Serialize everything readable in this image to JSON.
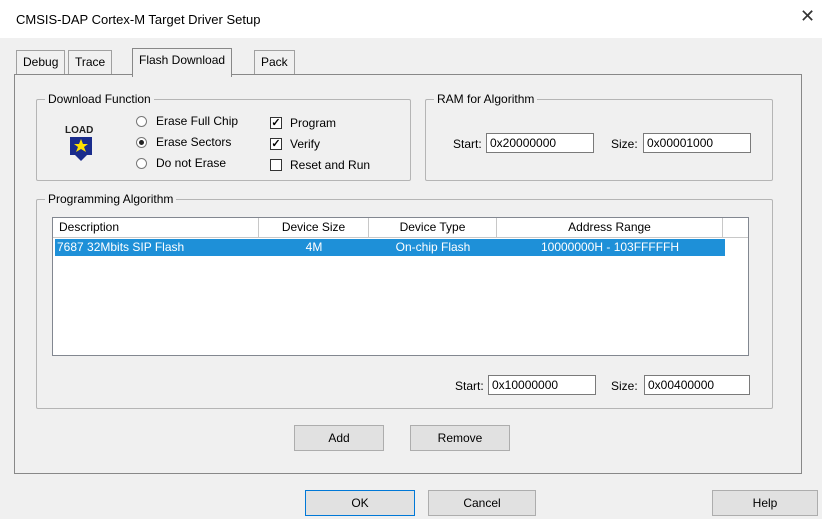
{
  "window": {
    "title": "CMSIS-DAP Cortex-M Target Driver Setup",
    "close_glyph": "✕"
  },
  "tabs": [
    {
      "label": "Debug"
    },
    {
      "label": "Trace"
    },
    {
      "label": "Flash Download"
    },
    {
      "label": "Pack"
    }
  ],
  "download_function": {
    "group_label": "Download Function",
    "load_icon_text": "LOAD",
    "radios": [
      {
        "label": "Erase Full Chip",
        "checked": false
      },
      {
        "label": "Erase Sectors",
        "checked": true
      },
      {
        "label": "Do not Erase",
        "checked": false
      }
    ],
    "checkboxes": [
      {
        "label": "Program",
        "checked": true
      },
      {
        "label": "Verify",
        "checked": true
      },
      {
        "label": "Reset and Run",
        "checked": false
      }
    ]
  },
  "ram": {
    "group_label": "RAM for Algorithm",
    "start_label": "Start:",
    "start_value": "0x20000000",
    "size_label": "Size:",
    "size_value": "0x00001000"
  },
  "programming": {
    "group_label": "Programming Algorithm",
    "columns": [
      "Description",
      "Device Size",
      "Device Type",
      "Address Range"
    ],
    "rows": [
      [
        "7687 32Mbits SIP Flash",
        "4M",
        "On-chip Flash",
        "10000000H - 103FFFFFH"
      ]
    ],
    "start_label": "Start:",
    "start_value": "0x10000000",
    "size_label": "Size:",
    "size_value": "0x00400000"
  },
  "buttons": {
    "add": "Add",
    "remove": "Remove",
    "ok": "OK",
    "cancel": "Cancel",
    "help": "Help"
  },
  "check_glyph": "✓"
}
